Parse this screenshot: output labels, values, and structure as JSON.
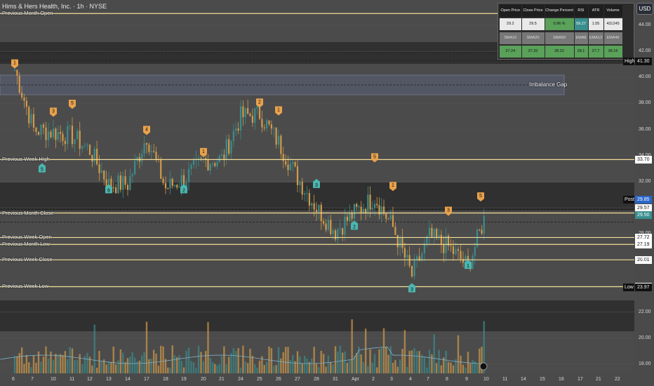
{
  "header": {
    "title": "Hims & Hers Health, Inc. · 1h · NYSE",
    "currency_button": "USD"
  },
  "levels": [
    {
      "name": "Previous Month Open",
      "value": 44.9,
      "badge": ""
    },
    {
      "name": "Previous Week High",
      "value": 33.7,
      "badge": "33.70"
    },
    {
      "name": "Previous Month Close",
      "value": 29.6,
      "badge": ""
    },
    {
      "name": "Previous Week Open",
      "value": 27.72,
      "badge": "27.72"
    },
    {
      "name": "Previous Month Low",
      "value": 27.19,
      "badge": "27.19"
    },
    {
      "name": "Previous Week Close",
      "value": 26.01,
      "badge": "26.01"
    },
    {
      "name": "Previous Week Low",
      "value": 23.95,
      "badge": "23.95"
    }
  ],
  "price_tags": {
    "high": {
      "label": "High",
      "value": "41.30"
    },
    "post": {
      "label": "Post",
      "value": "29.85"
    },
    "low": {
      "label": "Low",
      "value": "23.97"
    },
    "p1": "29.57",
    "p2": "29.50"
  },
  "imbalance": {
    "label": "Imbalance Gap"
  },
  "stats_table": {
    "headers1": [
      "Open Price",
      "Close Price",
      "Change Percent",
      "RSI",
      "ATR",
      "Volume"
    ],
    "values1": [
      "29.2",
      "29.5",
      "0.96 %",
      "59.27",
      "1.55",
      "431245"
    ],
    "headers2": [
      "SMA10",
      "SMA20",
      "SMA50",
      "EMA8",
      "EMA13",
      "EMA46"
    ],
    "values2": [
      "27.24",
      "27.32",
      "28.22",
      "28.1",
      "27.7",
      "28.16"
    ]
  },
  "chart_data": {
    "type": "candlestick",
    "title": "Hims & Hers Health, Inc. · 1h · NYSE",
    "ylim": [
      17.5,
      45.5
    ],
    "y_ticks": [
      "44.00",
      "42.00",
      "40.00",
      "38.00",
      "36.00",
      "34.00",
      "32.00",
      "30.00",
      "28.00",
      "26.00",
      "24.00",
      "22.00",
      "20.00",
      "18.00"
    ],
    "x_ticks": [
      "6",
      "7",
      "10",
      "11",
      "12",
      "13",
      "14",
      "17",
      "18",
      "19",
      "20",
      "21",
      "24",
      "25",
      "26",
      "27",
      "28",
      "31",
      "Apr",
      "2",
      "3",
      "4",
      "7",
      "8",
      "9",
      "10",
      "11",
      "14",
      "15",
      "16",
      "17",
      "21",
      "22"
    ],
    "close_path": [
      {
        "x": "6",
        "close": 40.6
      },
      {
        "x": "7",
        "close": 36.0
      },
      {
        "x": "10",
        "close": 35.8
      },
      {
        "x": "11",
        "close": 35.5
      },
      {
        "x": "12",
        "close": 34.4
      },
      {
        "x": "13",
        "close": 31.8
      },
      {
        "x": "14",
        "close": 31.8
      },
      {
        "x": "17",
        "close": 35.5
      },
      {
        "x": "18",
        "close": 31.5
      },
      {
        "x": "19",
        "close": 32.2
      },
      {
        "x": "20",
        "close": 33.6
      },
      {
        "x": "21",
        "close": 33.7
      },
      {
        "x": "24",
        "close": 37.0
      },
      {
        "x": "25",
        "close": 37.2
      },
      {
        "x": "26",
        "close": 35.0
      },
      {
        "x": "27",
        "close": 32.3
      },
      {
        "x": "28",
        "close": 30.0
      },
      {
        "x": "31",
        "close": 28.2
      },
      {
        "x": "Apr",
        "close": 29.6
      },
      {
        "x": "2",
        "close": 30.8
      },
      {
        "x": "3",
        "close": 28.5
      },
      {
        "x": "4",
        "close": 24.8
      },
      {
        "x": "7",
        "close": 27.8
      },
      {
        "x": "8",
        "close": 27.0
      },
      {
        "x": "9",
        "close": 25.5
      },
      {
        "x": "10",
        "close": 29.6
      }
    ],
    "volume_axis_shown": false,
    "wave_labels": [
      {
        "x": "6",
        "label": "1",
        "pos": "above"
      },
      {
        "x": "10",
        "label": "3",
        "pos": "above"
      },
      {
        "x": "11",
        "label": "5",
        "pos": "above"
      },
      {
        "x": "7",
        "label": "5",
        "pos": "below"
      },
      {
        "x": "13",
        "label": "6",
        "pos": "below"
      },
      {
        "x": "17",
        "label": "4",
        "pos": "above"
      },
      {
        "x": "19",
        "label": "2",
        "pos": "below"
      },
      {
        "x": "20",
        "label": "1",
        "pos": "above"
      },
      {
        "x": "25",
        "label": "2",
        "pos": "above"
      },
      {
        "x": "26",
        "label": "1",
        "pos": "above"
      },
      {
        "x": "28",
        "label": "3",
        "pos": "below"
      },
      {
        "x": "Apr",
        "label": "2",
        "pos": "below"
      },
      {
        "x": "2",
        "label": "5",
        "pos": "above"
      },
      {
        "x": "3",
        "label": "1",
        "pos": "above"
      },
      {
        "x": "4",
        "label": "3",
        "pos": "below"
      },
      {
        "x": "8",
        "label": "3",
        "pos": "above"
      },
      {
        "x": "9",
        "label": "1",
        "pos": "below"
      },
      {
        "x": "10",
        "label": "5",
        "pos": "above"
      }
    ]
  },
  "colors": {
    "up": "#3b8d8d",
    "down": "#d29a4a",
    "level": "#f3dd97",
    "wave_up": "#e9a24d",
    "wave_down": "#4cb6b0"
  }
}
